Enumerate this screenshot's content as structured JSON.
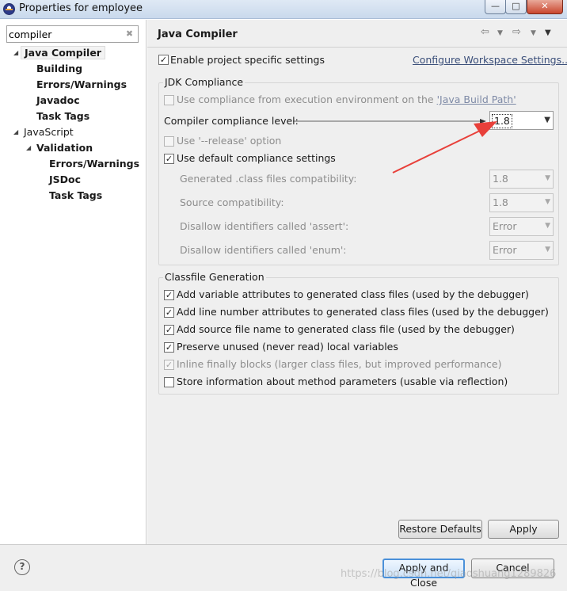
{
  "window": {
    "title": "Properties for employee"
  },
  "filter": {
    "value": "compiler"
  },
  "tree": {
    "java_compiler": "Java Compiler",
    "building": "Building",
    "errors_warnings": "Errors/Warnings",
    "javadoc": "Javadoc",
    "task_tags": "Task Tags",
    "javascript": "JavaScript",
    "validation": "Validation",
    "js_errors_warnings": "Errors/Warnings",
    "jsdoc": "JSDoc",
    "js_task_tags": "Task Tags"
  },
  "page": {
    "title": "Java Compiler",
    "enable_project_specific": "Enable project specific settings",
    "configure_workspace": "Configure Workspace Settings..."
  },
  "jdk": {
    "group_title": "JDK Compliance",
    "use_compliance_prefix": "Use compliance from execution environment on the ",
    "use_compliance_link": "'Java Build Path'",
    "compliance_label": "Compiler compliance level:",
    "compliance_value": "1.8",
    "release_option": "Use '--release' option",
    "use_default": "Use default compliance settings",
    "generated_label": "Generated .class files compatibility:",
    "generated_value": "1.8",
    "source_label": "Source compatibility:",
    "source_value": "1.8",
    "assert_label": "Disallow identifiers called 'assert':",
    "assert_value": "Error",
    "enum_label": "Disallow identifiers called 'enum':",
    "enum_value": "Error"
  },
  "classfile": {
    "group_title": "Classfile Generation",
    "variable_attrs": "Add variable attributes to generated class files (used by the debugger)",
    "line_number_attrs": "Add line number attributes to generated class files (used by the debugger)",
    "source_file_name": "Add source file name to generated class file (used by the debugger)",
    "preserve_unused": "Preserve unused (never read) local variables",
    "inline_finally": "Inline finally blocks (larger class files, but improved performance)",
    "store_method_params": "Store information about method parameters (usable via reflection)"
  },
  "buttons": {
    "restore_defaults": "Restore Defaults",
    "apply": "Apply",
    "apply_and_close": "Apply and Close",
    "cancel": "Cancel",
    "help": "?"
  },
  "watermark": "https://blog.csdn.net/qiaoshuang1289826",
  "colors": {
    "annotation_arrow": "#e8403a",
    "default_button_border": "#4a90d9"
  }
}
